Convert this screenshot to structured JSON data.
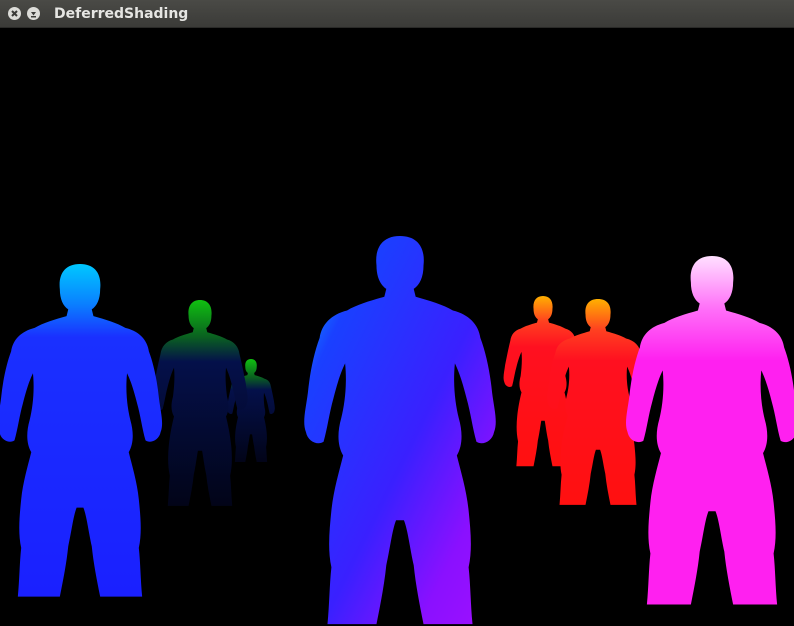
{
  "window": {
    "title": "DeferredShading",
    "buttons": {
      "close_icon": "close-icon",
      "minimize_icon": "minimize-icon"
    }
  },
  "scene": {
    "description_colors": {
      "background": "#000000",
      "cyan": "#00c8ff",
      "blue": "#1a2cff",
      "green": "#10b010",
      "dark_navy": "#050a40",
      "red": "#ff1a1a",
      "orange": "#ffb000",
      "magenta": "#ff20f0",
      "pink": "#ffb8f8"
    }
  }
}
